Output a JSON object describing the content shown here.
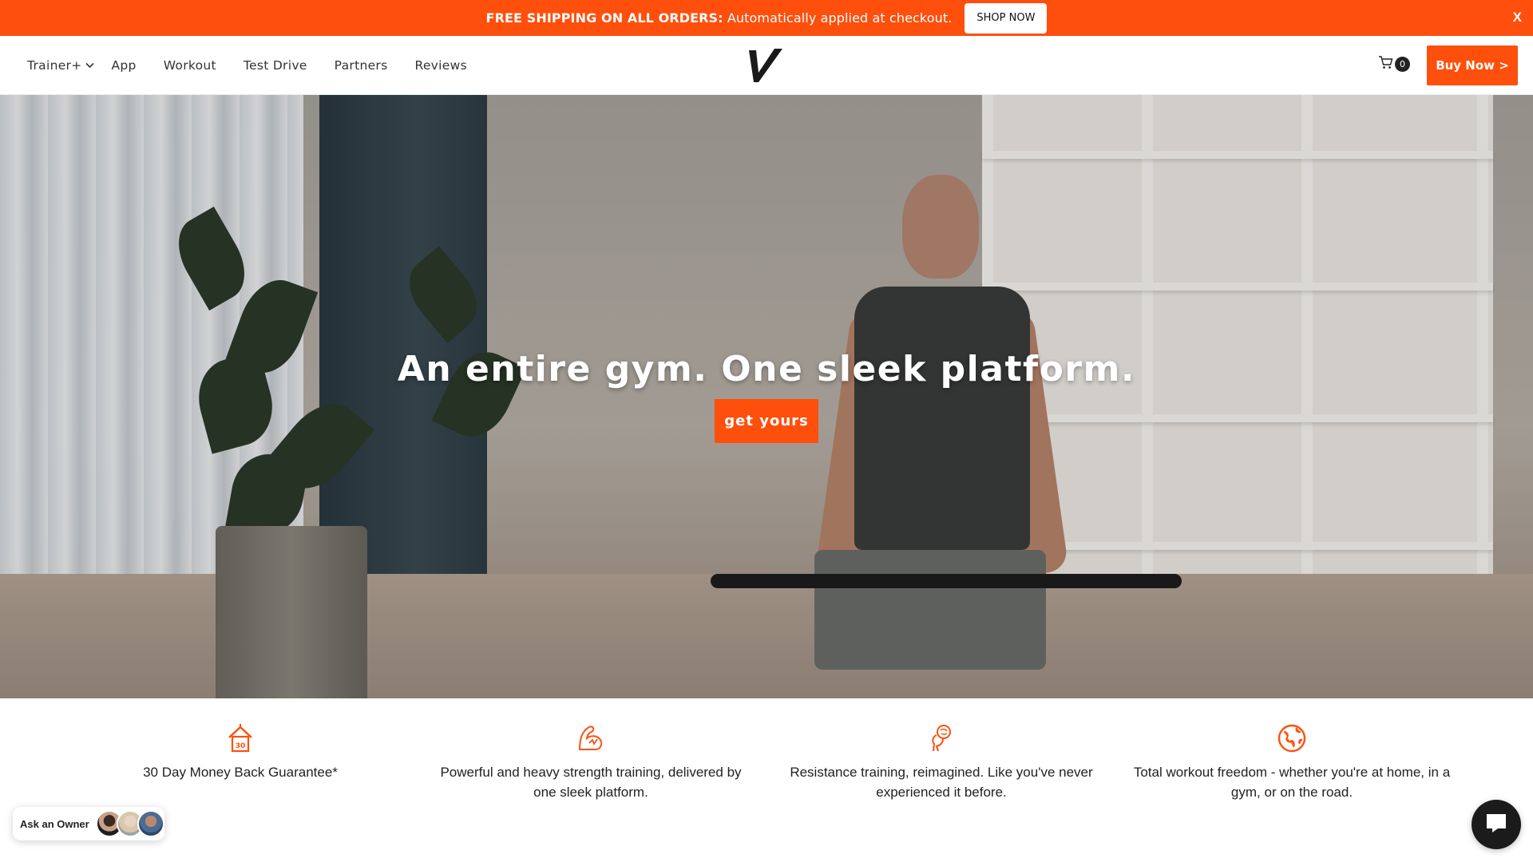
{
  "promo": {
    "bold": "FREE SHIPPING ON ALL ORDERS:",
    "text": " Automatically applied at checkout.",
    "button": "SHOP NOW",
    "close": "X"
  },
  "nav": {
    "items": [
      {
        "label": "Trainer+",
        "has_dropdown": true
      },
      {
        "label": "App"
      },
      {
        "label": "Workout"
      },
      {
        "label": "Test Drive"
      },
      {
        "label": "Partners"
      },
      {
        "label": "Reviews"
      }
    ],
    "logo_alt": "V",
    "cart_count": "0",
    "buy_button": "Buy Now >"
  },
  "hero": {
    "title": "An entire gym. One sleek platform.",
    "cta": "get yours"
  },
  "features": [
    {
      "icon": "house-30-icon",
      "text": "30 Day Money Back Guarantee*"
    },
    {
      "icon": "flexed-arm-icon",
      "text": "Powerful and heavy strength training, delivered by one sleek platform."
    },
    {
      "icon": "head-brain-icon",
      "text": "Resistance training, reimagined. Like you've never experienced it before."
    },
    {
      "icon": "globe-icon",
      "text": "Total workout freedom - whether you're at home, in a gym, or on the road."
    }
  ],
  "widgets": {
    "ask_label": "Ask an Owner",
    "chat_icon": "chat-bubble-icon"
  },
  "colors": {
    "accent": "#fe4f0d",
    "dark": "#1b1b1b"
  }
}
